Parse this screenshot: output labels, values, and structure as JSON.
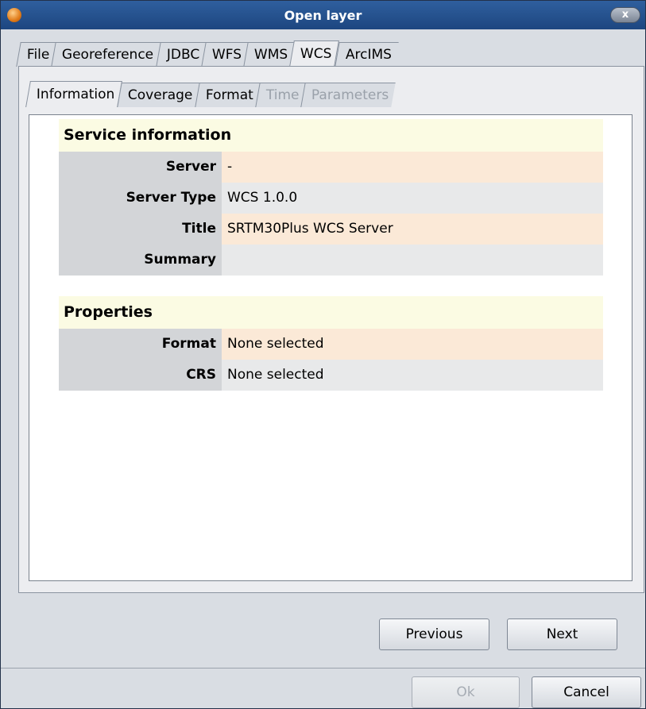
{
  "window": {
    "title": "Open layer",
    "close_label": "x"
  },
  "main_tabs": [
    "File",
    "Georeference",
    "JDBC",
    "WFS",
    "WMS",
    "WCS",
    "ArcIMS"
  ],
  "main_tab_active": "WCS",
  "inner_tabs": [
    {
      "label": "Information",
      "state": "active"
    },
    {
      "label": "Coverage",
      "state": "enabled"
    },
    {
      "label": "Format",
      "state": "enabled"
    },
    {
      "label": "Time",
      "state": "disabled"
    },
    {
      "label": "Parameters",
      "state": "disabled"
    }
  ],
  "service_info": {
    "heading": "Service information",
    "rows": [
      {
        "label": "Server",
        "value": "-"
      },
      {
        "label": "Server Type",
        "value": "WCS 1.0.0"
      },
      {
        "label": "Title",
        "value": "SRTM30Plus WCS Server"
      },
      {
        "label": "Summary",
        "value": ""
      }
    ]
  },
  "properties": {
    "heading": "Properties",
    "rows": [
      {
        "label": "Format",
        "value": "None selected"
      },
      {
        "label": "CRS",
        "value": "None selected"
      }
    ]
  },
  "buttons": {
    "previous": "Previous",
    "next": "Next",
    "ok": "Ok",
    "cancel": "Cancel"
  }
}
